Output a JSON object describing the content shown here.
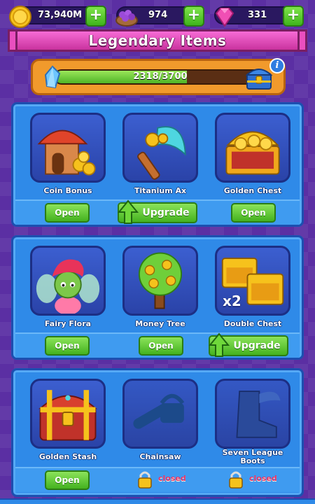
{
  "resources": {
    "coins": "73,940M",
    "grapes": "974",
    "gems": "331",
    "plus_label": "+"
  },
  "title": "Legendary Items",
  "progress": {
    "text": "2318/3700",
    "current": 2318,
    "max": 3700,
    "info_label": "i"
  },
  "sections": [
    {
      "items": [
        {
          "name": "Coin Bonus",
          "button": "Open",
          "button_type": "open"
        },
        {
          "name": "Titanium Ax",
          "button": "Upgrade",
          "button_type": "upgrade"
        },
        {
          "name": "Golden Chest",
          "button": "Open",
          "button_type": "open"
        }
      ]
    },
    {
      "items": [
        {
          "name": "Fairy Flora",
          "button": "Open",
          "button_type": "open"
        },
        {
          "name": "Money Tree",
          "button": "Open",
          "button_type": "open"
        },
        {
          "name": "Double Chest",
          "button": "Upgrade",
          "button_type": "upgrade",
          "badge": "x2"
        }
      ]
    },
    {
      "items": [
        {
          "name": "Golden Stash",
          "button": "Open",
          "button_type": "open"
        },
        {
          "name": "Chainsaw",
          "button": "closed",
          "button_type": "locked"
        },
        {
          "name": "Seven League Boots",
          "button": "closed",
          "button_type": "locked"
        }
      ]
    }
  ],
  "colors": {
    "background": "#5b2fa3",
    "panel_blue": "#2f8ae8",
    "button_green": "#44b21f",
    "banner_pink": "#e94fbf",
    "closed_red": "#e6336b"
  }
}
